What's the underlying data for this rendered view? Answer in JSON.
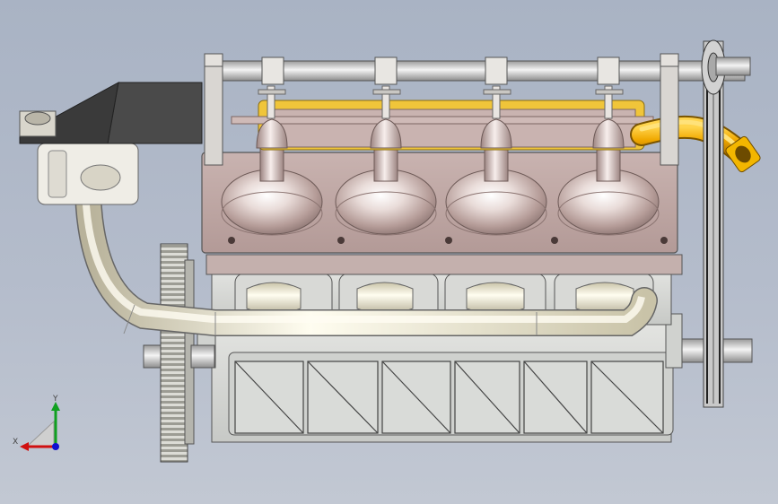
{
  "viewport": {
    "background_top": "#a9b3c4",
    "background_bottom": "#c2c8d3"
  },
  "model": {
    "cylinder_count": 4,
    "colors": {
      "cylinder_head": "#c2a9a6",
      "block": "#d7d9d6",
      "intake_pipe": "#f2efd8",
      "exhaust_pipe": "#e8a800",
      "air_filter_lid": "#3d3d3d",
      "valve_cover": "#f0c53a",
      "shaft": "#d8d8d8"
    }
  },
  "triad": {
    "x_label": "X",
    "y_label": "Y",
    "x_color": "#d01010",
    "y_color": "#10a020",
    "z_color": "#1010d0"
  }
}
